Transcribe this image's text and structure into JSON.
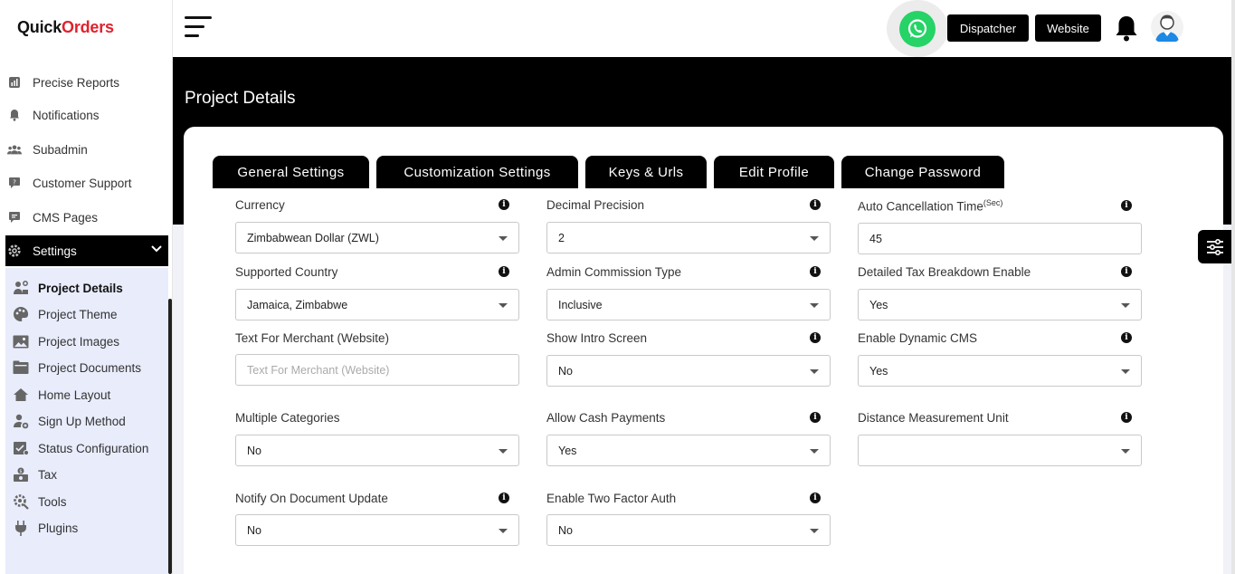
{
  "brand": {
    "logo_part1": "Quick",
    "logo_part2": "Orders"
  },
  "sidebar": {
    "items": [
      {
        "label": "Precise Reports",
        "icon": "report-icon"
      },
      {
        "label": "Notifications",
        "icon": "bell-icon"
      },
      {
        "label": "Subadmin",
        "icon": "users-icon"
      },
      {
        "label": "Customer Support",
        "icon": "support-icon"
      },
      {
        "label": "CMS Pages",
        "icon": "cms-icon"
      },
      {
        "label": "Settings",
        "icon": "gear-icon",
        "active": true
      }
    ],
    "submenu": [
      {
        "label": "Project Details",
        "icon": "project-details-icon",
        "current": true
      },
      {
        "label": "Project Theme",
        "icon": "palette-icon"
      },
      {
        "label": "Project Images",
        "icon": "image-icon"
      },
      {
        "label": "Project Documents",
        "icon": "documents-icon"
      },
      {
        "label": "Home Layout",
        "icon": "home-icon"
      },
      {
        "label": "Sign Up Method",
        "icon": "signup-icon"
      },
      {
        "label": "Status Configuration",
        "icon": "status-icon"
      },
      {
        "label": "Tax",
        "icon": "tax-icon"
      },
      {
        "label": "Tools",
        "icon": "tools-icon"
      },
      {
        "label": "Plugins",
        "icon": "plug-icon"
      }
    ]
  },
  "topbar": {
    "dispatcher_label": "Dispatcher",
    "website_label": "Website"
  },
  "page": {
    "title": "Project Details"
  },
  "tabs": [
    {
      "label": "General Settings",
      "active": true
    },
    {
      "label": "Customization Settings"
    },
    {
      "label": "Keys & Urls"
    },
    {
      "label": "Edit Profile"
    },
    {
      "label": "Change Password"
    }
  ],
  "form": {
    "currency": {
      "label": "Currency",
      "value": "Zimbabwean Dollar (ZWL)"
    },
    "decimal_precision": {
      "label": "Decimal Precision",
      "value": "2"
    },
    "auto_cancellation": {
      "label": "Auto Cancellation Time",
      "label_sup": "(Sec)",
      "value": "45"
    },
    "supported_country": {
      "label": "Supported Country",
      "value": "Jamaica, Zimbabwe"
    },
    "admin_commission_type": {
      "label": "Admin Commission Type",
      "value": "Inclusive"
    },
    "detailed_tax": {
      "label": "Detailed Tax Breakdown Enable",
      "value": "Yes"
    },
    "merchant_text": {
      "label": "Text For Merchant (Website)",
      "placeholder": "Text For Merchant (Website)"
    },
    "show_intro": {
      "label": "Show Intro Screen",
      "value": "No"
    },
    "dynamic_cms": {
      "label": "Enable Dynamic CMS",
      "value": "Yes"
    },
    "multiple_categories": {
      "label": "Multiple Categories",
      "value": "No"
    },
    "cash_payments": {
      "label": "Allow Cash Payments",
      "value": "Yes"
    },
    "distance_unit": {
      "label": "Distance Measurement Unit",
      "value": ""
    },
    "notify_doc_update": {
      "label": "Notify On Document Update",
      "value": "No"
    },
    "two_factor": {
      "label": "Enable Two Factor Auth",
      "value": "No"
    }
  },
  "info_glyph": "i"
}
